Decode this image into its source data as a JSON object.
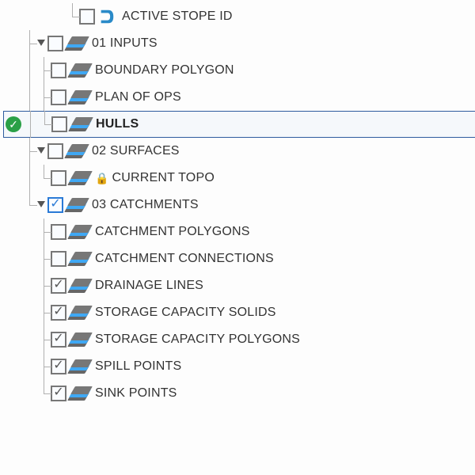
{
  "tree": {
    "items": [
      {
        "label": "ACTIVE STOPE ID",
        "id": "active-stope-id"
      },
      {
        "label": "01 INPUTS",
        "id": "inputs",
        "children": [
          {
            "label": "BOUNDARY POLYGON",
            "id": "boundary-polygon"
          },
          {
            "label": "PLAN OF OPS",
            "id": "plan-of-ops"
          },
          {
            "label": "HULLS",
            "id": "hulls",
            "selected": true,
            "status": "ok",
            "bold": true
          }
        ]
      },
      {
        "label": "02 SURFACES",
        "id": "surfaces",
        "children": [
          {
            "label": "CURRENT TOPO",
            "id": "current-topo",
            "locked": true
          }
        ]
      },
      {
        "label": "03 CATCHMENTS",
        "id": "catchments",
        "checked": true,
        "blue": true,
        "children": [
          {
            "label": "CATCHMENT POLYGONS",
            "id": "catchment-polygons"
          },
          {
            "label": "CATCHMENT CONNECTIONS",
            "id": "catchment-connections"
          },
          {
            "label": "DRAINAGE LINES",
            "id": "drainage-lines",
            "checked": true
          },
          {
            "label": "STORAGE CAPACITY SOLIDS",
            "id": "storage-capacity-solids",
            "checked": true
          },
          {
            "label": "STORAGE CAPACITY POLYGONS",
            "id": "storage-capacity-polygons",
            "checked": true
          },
          {
            "label": "SPILL POINTS",
            "id": "spill-points",
            "checked": true
          },
          {
            "label": "SINK POINTS",
            "id": "sink-points",
            "checked": true
          }
        ]
      }
    ]
  }
}
